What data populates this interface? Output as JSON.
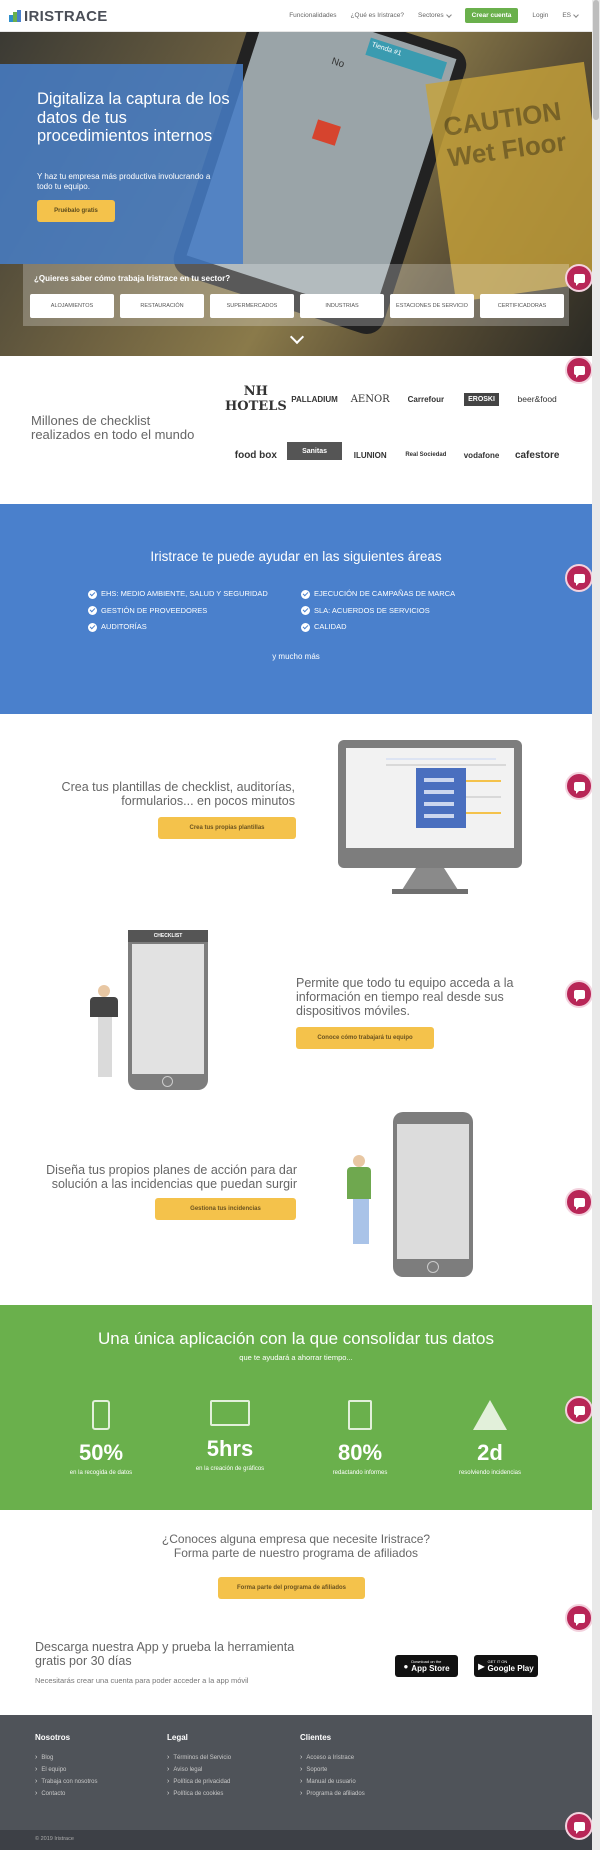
{
  "brand": {
    "name": "IRISTRACE",
    "accent_blue": "#4a80cc",
    "accent_green": "#6ab04c",
    "accent_yellow": "#f4c24b",
    "chat_color": "#b82657"
  },
  "nav": {
    "features": "Funcionalidades",
    "what": "¿Qué es Iristrace?",
    "sectors": "Sectores",
    "create": "Crear cuenta",
    "login": "Login",
    "lang": "ES"
  },
  "hero": {
    "title": "Digitaliza la captura de los datos de tus procedimientos internos",
    "subtitle": "Y haz tu empresa más productiva involucrando a todo tu equipo.",
    "cta": "Pruébalo gratis",
    "phone_no": "No",
    "phone_store": "Tienda #1",
    "sign_text": "CAUTION Wet Floor",
    "sector_question": "¿Quieres saber cómo trabaja Iristrace en tu sector?",
    "sectors": [
      "Alojamientos",
      "Restauración",
      "Supermercados",
      "Industrias",
      "Estaciones de servicio",
      "Certificadoras"
    ]
  },
  "clients": {
    "lead": "Millones de checklist realizados en todo el mundo",
    "logos": [
      "NH HOTELS",
      "PALLADIUM",
      "AENOR",
      "Carrefour",
      "EROSKI",
      "beer&food",
      "food box",
      "Sanitas",
      "ILUNION",
      "Real Sociedad",
      "vodafone",
      "cafestore"
    ]
  },
  "areas": {
    "title": "Iristrace te puede ayudar en las siguientes áreas",
    "left": [
      "EHS: MEDIO AMBIENTE, SALUD Y SEGURIDAD",
      "GESTIÓN DE PROVEEDORES",
      "AUDITORÍAS"
    ],
    "right": [
      "EJECUCIÓN DE CAMPAÑAS DE MARCA",
      "SLA: ACUERDOS DE SERVICIOS",
      "CALIDAD"
    ],
    "more": "y mucho más"
  },
  "features": {
    "f1": {
      "text": "Crea tus plantillas de checklist, auditorías, formularios... en pocos minutos",
      "cta": "Crea tus propias plantillas"
    },
    "f2": {
      "text": "Permite que todo tu equipo acceda a la información en tiempo real desde sus dispositivos móviles.",
      "cta": "Conoce cómo trabajará tu equipo",
      "phone_header": "CHECKLIST"
    },
    "f3": {
      "text": "Diseña tus propios planes de acción para dar solución a las incidencias que puedan surgir",
      "cta": "Gestiona tus incidencias"
    }
  },
  "stats": {
    "title": "Una única aplicación con la que consolidar tus datos",
    "subtitle": "que te ayudará a ahorrar tiempo...",
    "items": [
      {
        "value": "50%",
        "label": "en la recogida de datos",
        "icon": "mobile-icon"
      },
      {
        "value": "5hrs",
        "label": "en la creación de gráficos",
        "icon": "chart-board-icon"
      },
      {
        "value": "80%",
        "label": "redactando informes",
        "icon": "documents-icon"
      },
      {
        "value": "2d",
        "label": "resolviendo incidencias",
        "icon": "warning-icon"
      }
    ]
  },
  "affiliate": {
    "title": "¿Conoces alguna empresa que necesite Iristrace? Forma parte de nuestro programa de afiliados",
    "cta": "Forma parte del programa de afiliados"
  },
  "app": {
    "title": "Descarga nuestra App y prueba la herramienta gratis por 30 días",
    "note": "Necesitarás crear una cuenta para poder acceder a la app móvil",
    "appstore_small": "Download on the",
    "appstore": "App Store",
    "googleplay_small": "GET IT ON",
    "googleplay": "Google Play"
  },
  "footer": {
    "cols": [
      {
        "title": "Nosotros",
        "links": [
          "Blog",
          "El equipo",
          "Trabaja con nosotros",
          "Contacto"
        ]
      },
      {
        "title": "Legal",
        "links": [
          "Términos del Servicio",
          "Aviso legal",
          "Política de privacidad",
          "Política de cookies"
        ]
      },
      {
        "title": "Clientes",
        "links": [
          "Acceso a Iristrace",
          "Soporte",
          "Manual de usuario",
          "Programa de afiliados"
        ]
      }
    ],
    "copyright": "© 2019 Iristrace"
  }
}
